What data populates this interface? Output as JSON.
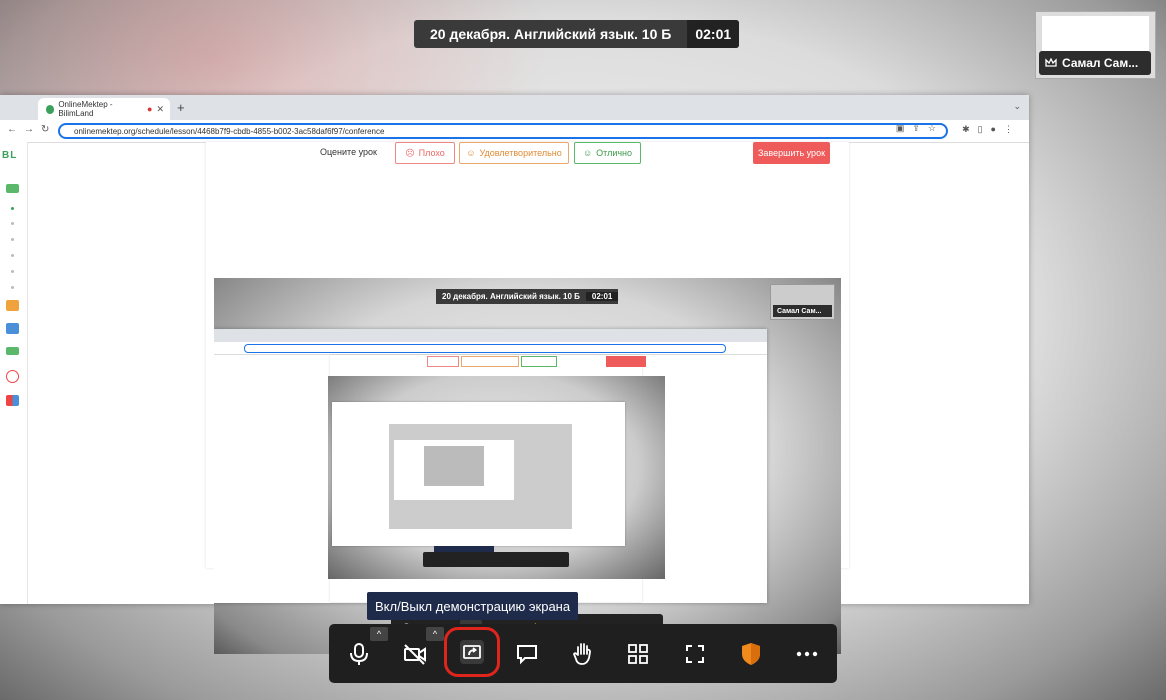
{
  "meeting": {
    "title": "20 декабря. Английский язык. 10 Б",
    "timer": "02:01",
    "participant_name": "Самал Сам..."
  },
  "browser": {
    "tab_title": "OnlineMektep - BilimLand",
    "url": "onlinemektep.org/schedule/lesson/4468b7f9-cbdb-4855-b002-3ac58daf6f97/conference"
  },
  "sidebar": {
    "logo": "BL"
  },
  "lesson_page": {
    "rate_label": "Оцените урок",
    "rate_bad": "Плохо",
    "rate_ok": "Удовлетворительно",
    "rate_good": "Отлично",
    "end_lesson": "Завершить урок"
  },
  "toolbar": {
    "tooltip": "Вкл/Выкл демонстрацию экрана",
    "colors": {
      "bg": "#1f1f1f",
      "highlight": "#e0251c",
      "tooltip_bg": "#1f2b4a",
      "shield": "#f08a1c"
    }
  }
}
